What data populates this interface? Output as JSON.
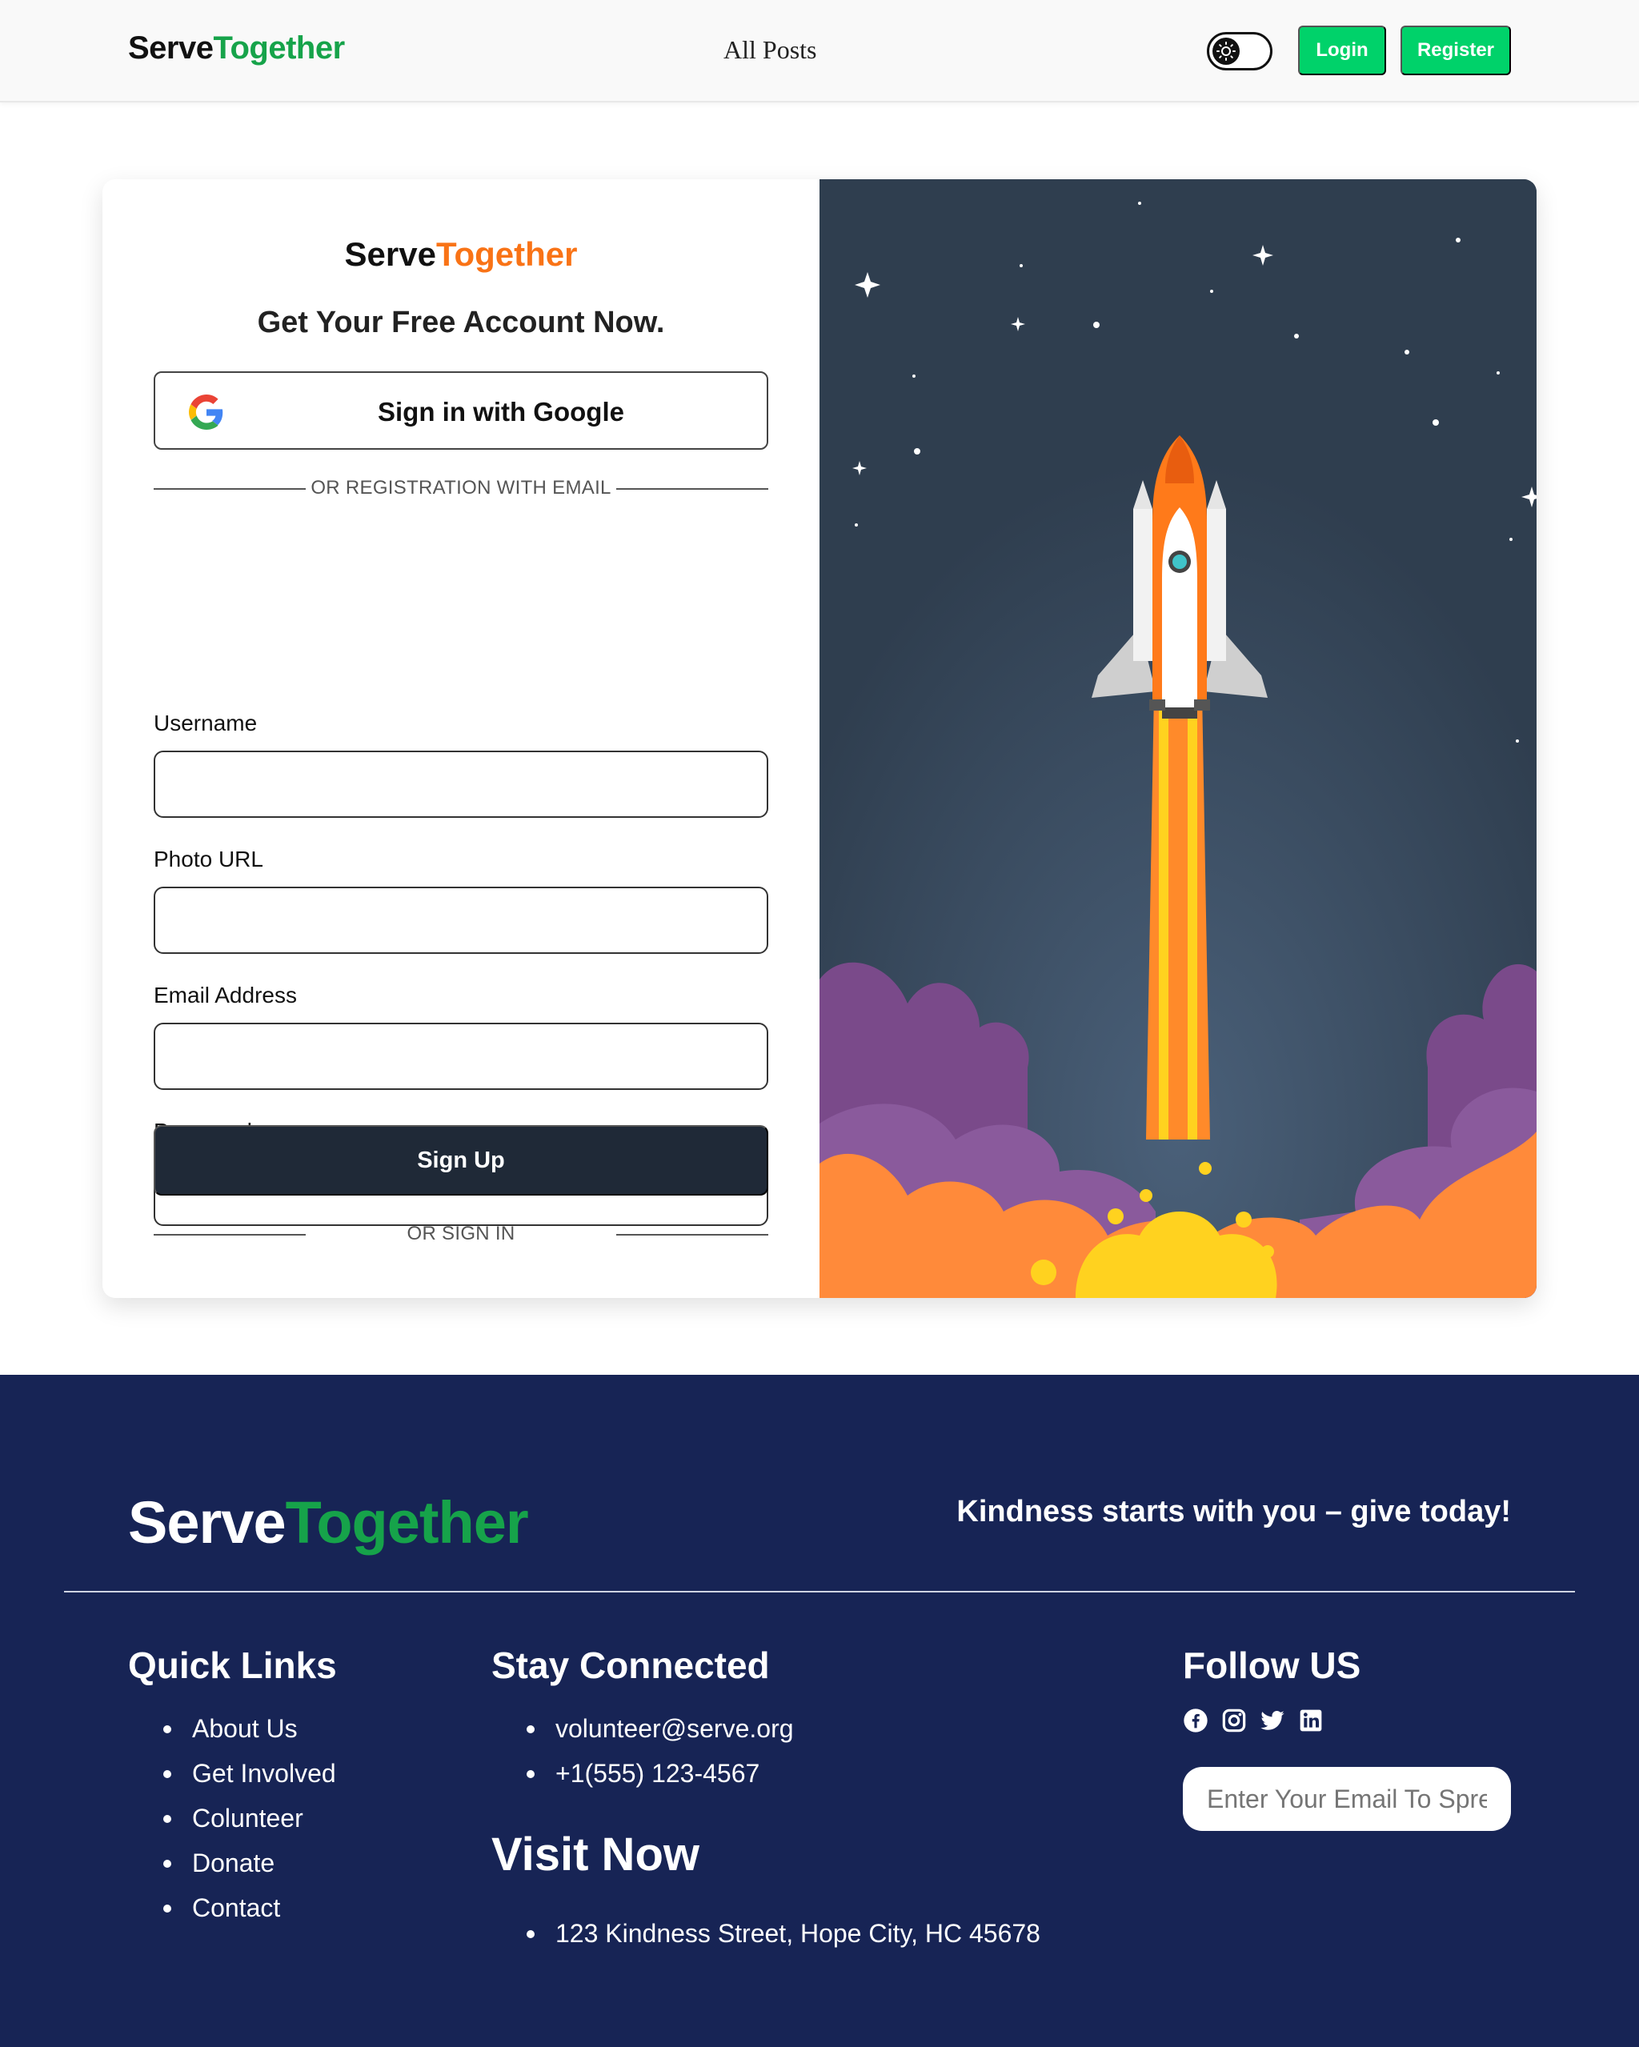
{
  "navbar": {
    "logo_part1": "Serve",
    "logo_part2": "Together",
    "link_all_posts": "All Posts",
    "login_label": "Login",
    "register_label": "Register"
  },
  "form": {
    "logo_part1": "Serve",
    "logo_part2": "Together",
    "heading": "Get Your Free Account Now.",
    "google_label": "Sign in with Google",
    "divider_email": "OR REGISTRATION WITH EMAIL",
    "fields": [
      {
        "label": "Username",
        "value": "",
        "placeholder": ""
      },
      {
        "label": "Photo URL",
        "value": "",
        "placeholder": ""
      },
      {
        "label": "Email Address",
        "value": "",
        "placeholder": ""
      },
      {
        "label": "Password",
        "value": "",
        "placeholder": ""
      }
    ],
    "signup_label": "Sign Up",
    "divider_signin": "OR SIGN IN"
  },
  "footer": {
    "logo_part1": "Serve",
    "logo_part2": "Together",
    "tagline": "Kindness starts with you – give today!",
    "quick_links": {
      "heading": "Quick Links",
      "items": [
        "About Us",
        "Get Involved",
        "Colunteer",
        "Donate",
        "Contact"
      ]
    },
    "stay_connected": {
      "heading": "Stay Connected",
      "items": [
        "volunteer@serve.org",
        "+1(555) 123-4567"
      ]
    },
    "visit_now": {
      "heading": "Visit Now",
      "items": [
        "123 Kindness Street, Hope City, HC 45678"
      ]
    },
    "follow_us": {
      "heading": "Follow US",
      "icons": [
        "facebook-icon",
        "instagram-icon",
        "twitter-icon",
        "linkedin-icon"
      ],
      "newsletter_placeholder": "Enter Your Email To Spread"
    }
  },
  "colors": {
    "brand_green": "#16a34a",
    "button_green": "#00d26a",
    "brand_orange": "#f97316",
    "footer_bg": "#172455",
    "signup_bg": "#1f2937"
  }
}
